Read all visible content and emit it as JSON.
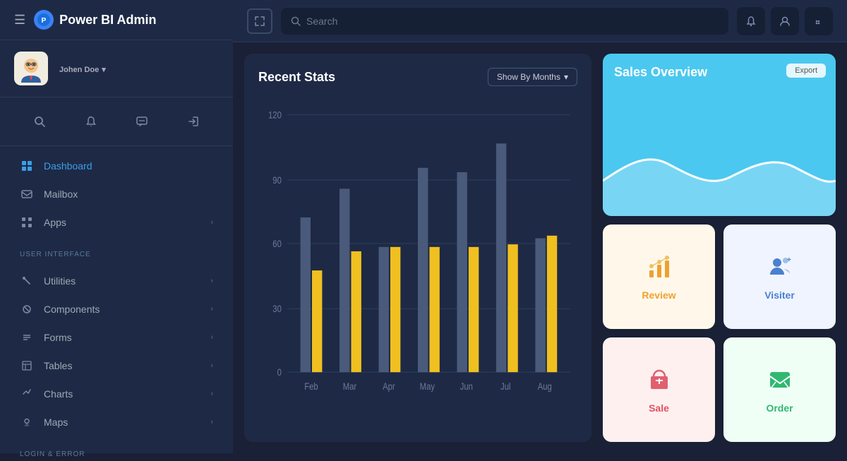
{
  "brand": {
    "name": "Power BI Admin",
    "logo_text": "P"
  },
  "user": {
    "name": "Johen Doe",
    "dropdown_indicator": "▾"
  },
  "sidebar": {
    "hamburger": "☰",
    "search_icon": "🔍",
    "bell_icon": "🔔",
    "chat_icon": "💬",
    "logout_icon": "→",
    "nav_items": [
      {
        "id": "dashboard",
        "label": "Dashboard",
        "icon": "⊞",
        "active": true,
        "arrow": false
      },
      {
        "id": "mailbox",
        "label": "Mailbox",
        "icon": "✉",
        "active": false,
        "arrow": false
      },
      {
        "id": "apps",
        "label": "Apps",
        "icon": "⊞",
        "active": false,
        "arrow": true
      }
    ],
    "section_user_interface": "USER INTERFACE",
    "ui_items": [
      {
        "id": "utilities",
        "label": "Utilities",
        "icon": "✏",
        "arrow": true
      },
      {
        "id": "components",
        "label": "Components",
        "icon": "⚙",
        "arrow": true
      },
      {
        "id": "forms",
        "label": "Forms",
        "icon": "≡",
        "arrow": true
      },
      {
        "id": "tables",
        "label": "Tables",
        "icon": "⊟",
        "arrow": true
      },
      {
        "id": "charts",
        "label": "Charts",
        "icon": "◀",
        "arrow": true
      },
      {
        "id": "maps",
        "label": "Maps",
        "icon": "📍",
        "arrow": true
      }
    ],
    "section_login": "LOGIN & ERROR"
  },
  "topbar": {
    "search_placeholder": "Search",
    "expand_icon": "⤢",
    "search_icon_char": "🔍",
    "bell_icon_char": "🔔",
    "user_icon_char": "👤",
    "dots_icon_char": "⁝⁝"
  },
  "chart": {
    "title": "Recent Stats",
    "filter_label": "Show By Months",
    "filter_arrow": "▾",
    "y_labels": [
      "120",
      "90",
      "60",
      "30",
      "0"
    ],
    "x_labels": [
      "Feb",
      "Mar",
      "Apr",
      "May",
      "Jun",
      "Jul",
      "Aug"
    ],
    "bars": [
      {
        "month": "Feb",
        "gray": 72,
        "yellow": 47
      },
      {
        "month": "Mar",
        "gray": 85,
        "yellow": 56
      },
      {
        "month": "Apr",
        "gray": 58,
        "yellow": 58
      },
      {
        "month": "May",
        "gray": 95,
        "yellow": 58
      },
      {
        "month": "Jun",
        "gray": 93,
        "yellow": 58
      },
      {
        "month": "Jul",
        "gray": 106,
        "yellow": 59
      },
      {
        "month": "Aug",
        "gray": 62,
        "yellow": 63
      }
    ]
  },
  "sales_overview": {
    "title": "Sales Overview",
    "export_label": "Export"
  },
  "stat_cards": [
    {
      "id": "review",
      "label": "Review",
      "icon": "📊",
      "type": "review"
    },
    {
      "id": "visiter",
      "label": "Visiter",
      "icon": "👤",
      "type": "visiter"
    },
    {
      "id": "sale",
      "label": "Sale",
      "icon": "🛒",
      "type": "sale"
    },
    {
      "id": "order",
      "label": "Order",
      "icon": "✉",
      "type": "order"
    }
  ]
}
